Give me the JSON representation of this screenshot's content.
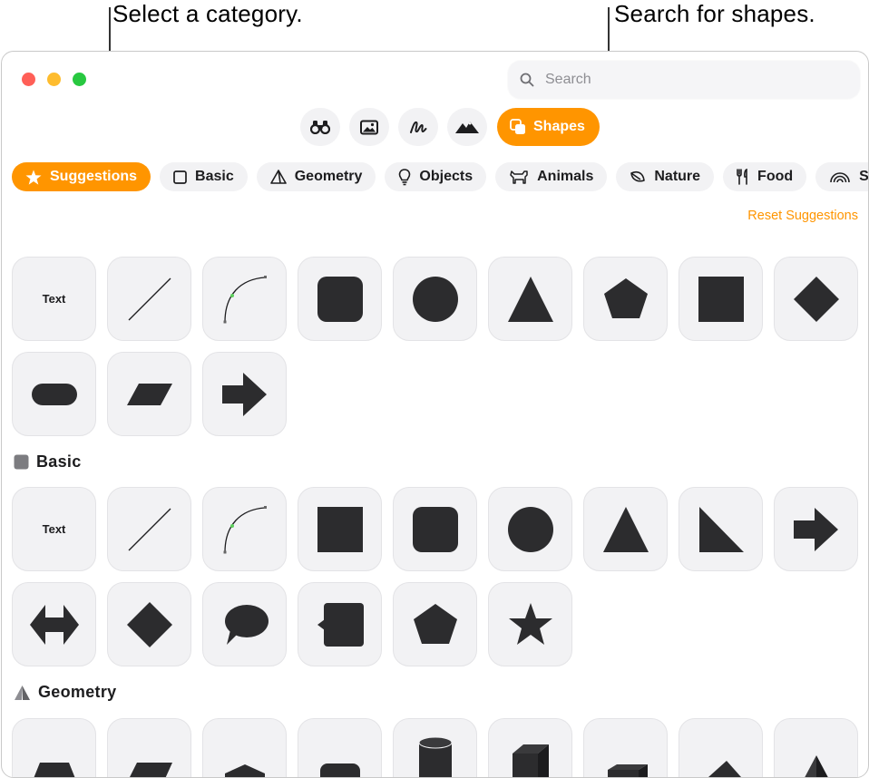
{
  "callouts": {
    "category": "Select a category.",
    "search": "Search for shapes."
  },
  "colors": {
    "accent": "#ff9500",
    "close": "#ff5f57",
    "minimize": "#febc2e",
    "zoom": "#28c840",
    "shape_fill": "#2c2c2e"
  },
  "search": {
    "placeholder": "Search",
    "value": ""
  },
  "modes": {
    "items": [
      {
        "icon": "binoculars-icon"
      },
      {
        "icon": "photo-icon"
      },
      {
        "icon": "scribble-icon"
      },
      {
        "icon": "mountains-icon"
      }
    ],
    "active_label": "Shapes",
    "active_icon": "shapes-icon"
  },
  "categories": [
    {
      "label": "Suggestions",
      "icon": "star-icon",
      "active": true
    },
    {
      "label": "Basic",
      "icon": "square-icon"
    },
    {
      "label": "Geometry",
      "icon": "pyramid-icon"
    },
    {
      "label": "Objects",
      "icon": "lightbulb-icon"
    },
    {
      "label": "Animals",
      "icon": "dog-icon"
    },
    {
      "label": "Nature",
      "icon": "leaf-icon"
    },
    {
      "label": "Food",
      "icon": "fork-knife-icon"
    },
    {
      "label": "Sy",
      "icon": "rainbow-icon"
    }
  ],
  "reset_label": "Reset Suggestions",
  "suggestions": {
    "items": [
      "Text",
      "line",
      "curve",
      "rounded-square",
      "circle",
      "triangle",
      "pentagon",
      "square",
      "diamond",
      "pill",
      "parallelogram",
      "arrow"
    ]
  },
  "basic": {
    "title": "Basic",
    "items": [
      "Text",
      "line",
      "curve",
      "square",
      "rounded-square",
      "circle",
      "triangle",
      "right-triangle",
      "arrow",
      "double-arrow",
      "diamond",
      "speech-bubble",
      "callout-square",
      "pentagon",
      "star"
    ]
  },
  "geometry": {
    "title": "Geometry",
    "items": [
      "trapezoid",
      "parallelogram",
      "house",
      "rounded-rect",
      "cylinder",
      "cube",
      "box",
      "pyramid",
      "tetrahedron"
    ]
  }
}
